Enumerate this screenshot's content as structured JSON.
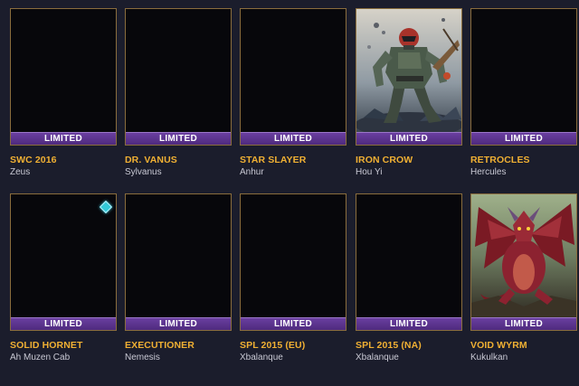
{
  "badge_label": "LIMITED",
  "colors": {
    "background": "#1b1d2c",
    "card_border": "#8a6d3d",
    "badge": "#5b3490",
    "skin_name": "#f0b033",
    "god_name": "#c9c9d4"
  },
  "skins": [
    {
      "skin": "SWC 2016",
      "god": "Zeus",
      "art": "empty"
    },
    {
      "skin": "DR. VANUS",
      "god": "Sylvanus",
      "art": "empty"
    },
    {
      "skin": "STAR SLAYER",
      "god": "Anhur",
      "art": "empty"
    },
    {
      "skin": "IRON CROW",
      "god": "Hou Yi",
      "art": "armored-soldier"
    },
    {
      "skin": "RETROCLES",
      "god": "Hercules",
      "art": "empty"
    },
    {
      "skin": "SOLID HORNET",
      "god": "Ah Muzen Cab",
      "art": "empty",
      "gem_icon": "diamond-icon"
    },
    {
      "skin": "EXECUTIONER",
      "god": "Nemesis",
      "art": "empty"
    },
    {
      "skin": "SPL 2015 (EU)",
      "god": "Xbalanque",
      "art": "empty"
    },
    {
      "skin": "SPL 2015 (NA)",
      "god": "Xbalanque",
      "art": "empty"
    },
    {
      "skin": "VOID WYRM",
      "god": "Kukulkan",
      "art": "red-dragon"
    }
  ]
}
